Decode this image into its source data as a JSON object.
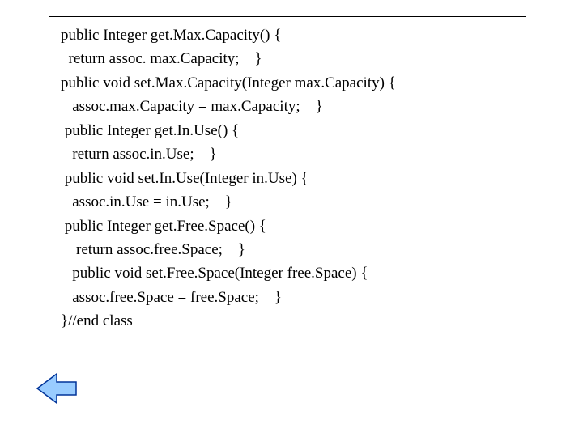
{
  "code": {
    "l1": "public Integer get.Max.Capacity() {",
    "l2": "  return assoc. max.Capacity;    }",
    "l3": "public void set.Max.Capacity(Integer max.Capacity) {",
    "l4": "   assoc.max.Capacity = max.Capacity;    }",
    "l5": " public Integer get.In.Use() {",
    "l6": "   return assoc.in.Use;    }",
    "l7": " public void set.In.Use(Integer in.Use) {",
    "l8": "   assoc.in.Use = in.Use;    }",
    "l9": " public Integer get.Free.Space() {",
    "l10": "    return assoc.free.Space;    }",
    "l11": "   public void set.Free.Space(Integer free.Space) {",
    "l12": "   assoc.free.Space = free.Space;    }",
    "l13": "}//end class"
  },
  "nav": {
    "back_label": "Back"
  },
  "colors": {
    "arrow_fill": "#99ccff",
    "arrow_stroke": "#003399"
  }
}
